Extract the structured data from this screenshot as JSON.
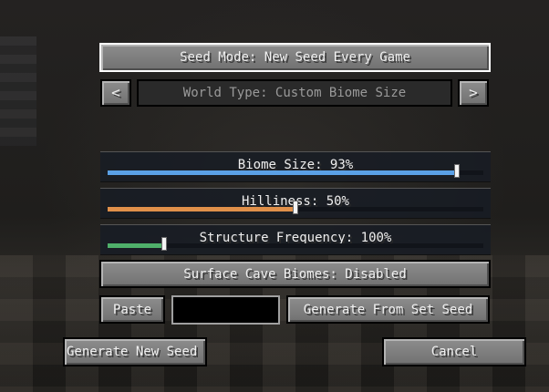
{
  "seed_mode": {
    "label": "Seed Mode: New Seed Every Game"
  },
  "world_type": {
    "prev_glyph": "<",
    "label": "World Type: Custom Biome Size",
    "next_glyph": ">"
  },
  "sliders": [
    {
      "label": "Biome Size: 93%",
      "value_pct": 93,
      "color": "#5aa0e6"
    },
    {
      "label": "Hilliness: 50%",
      "value_pct": 50,
      "color": "#e0904a"
    },
    {
      "label": "Structure Frequency: 100%",
      "value_pct": 15,
      "color": "#4fb06a"
    }
  ],
  "surface_caves": {
    "label": "Surface Cave Biomes: Disabled"
  },
  "seed_row": {
    "paste_label": "Paste",
    "seed_value": "",
    "generate_from_seed_label": "Generate From Set Seed"
  },
  "footer": {
    "generate_new_seed_label": "Generate New Seed",
    "cancel_label": "Cancel"
  }
}
